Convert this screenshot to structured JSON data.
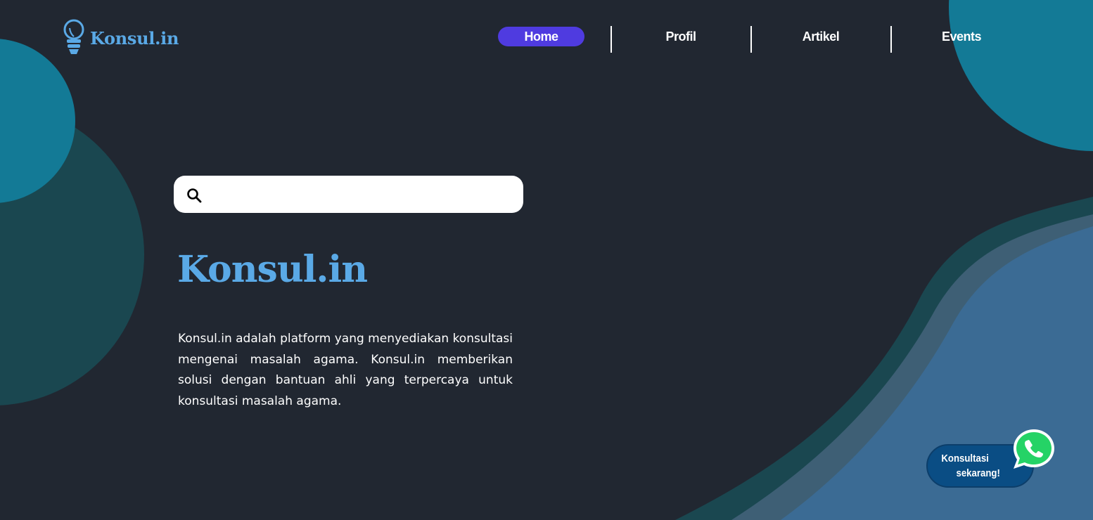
{
  "brand": {
    "name": "Konsul.in",
    "logo_icon": "lightbulb-icon",
    "color": "#5aa9e6"
  },
  "nav": {
    "items": [
      {
        "label": "Home",
        "active": true
      },
      {
        "label": "Profil",
        "active": false
      },
      {
        "label": "Artikel",
        "active": false
      },
      {
        "label": "Events",
        "active": false
      }
    ],
    "active_color": "#4f3be0"
  },
  "search": {
    "icon": "search-icon",
    "placeholder": "",
    "value": ""
  },
  "hero": {
    "title": "Konsul.in",
    "description": "Konsul.in adalah platform yang menyediakan konsultasi mengenai masalah agama. Konsul.in memberikan solusi dengan bantuan ahli yang terpercaya untuk konsultasi masalah agama."
  },
  "whatsapp": {
    "line1": "Konsultasi",
    "line2": "sekarang!",
    "icon": "whatsapp-icon",
    "pill_color": "#0a4d84",
    "icon_color": "#25d366"
  },
  "colors": {
    "background": "#212731",
    "teal": "#137a96",
    "dark_teal": "#1a4750",
    "slate": "#3e5f75",
    "steel_blue": "#3b6b94"
  }
}
